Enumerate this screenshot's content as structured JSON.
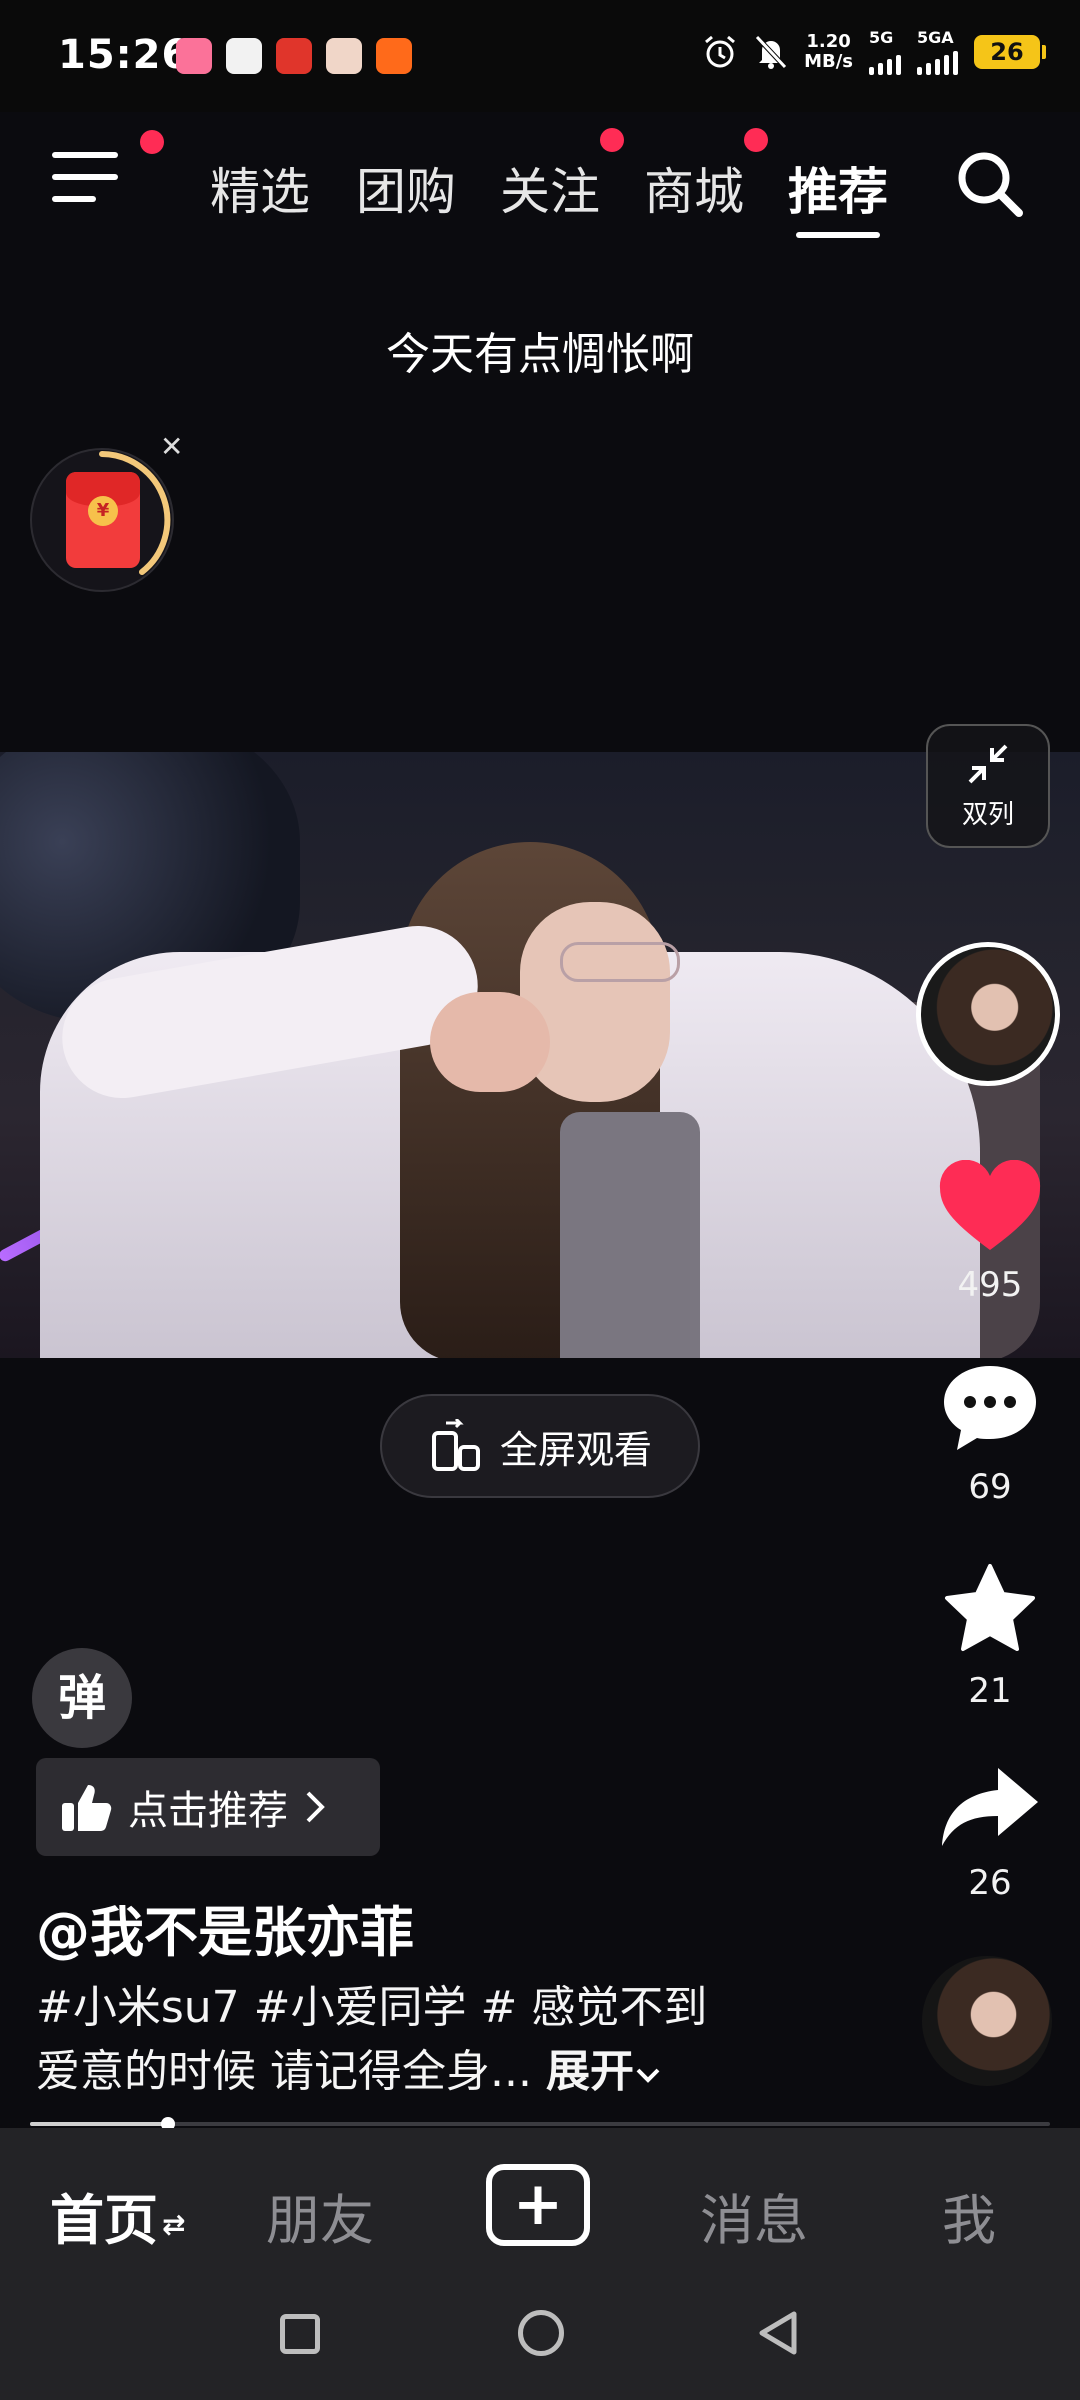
{
  "status_bar": {
    "time": "15:26",
    "net_speed_value": "1.20",
    "net_speed_unit": "MB/s",
    "sim1": "5G",
    "sim2": "5GA",
    "battery": "26",
    "notification_apps": [
      "bilibili-icon",
      "app-icon",
      "music-icon",
      "avatar-app-icon",
      "feishu-icon"
    ]
  },
  "top_nav": {
    "tabs": [
      {
        "label": "精选",
        "dot": false
      },
      {
        "label": "团购",
        "dot": false
      },
      {
        "label": "关注",
        "dot": true
      },
      {
        "label": "商城",
        "dot": true
      },
      {
        "label": "推荐",
        "dot": false,
        "active": true
      }
    ]
  },
  "video": {
    "caption": "今天有点惆怅啊",
    "fullscreen_label": "全屏观看"
  },
  "red_packet": {
    "coin": "¥"
  },
  "right_rail": {
    "dual_col_label": "双列",
    "likes": "495",
    "comments": "69",
    "favorites": "21",
    "shares": "26"
  },
  "post": {
    "danmu_label": "弹",
    "recommend_label": "点击推荐",
    "author": "@我不是张亦菲",
    "desc_line1": "#小米su7 #小爱同学 # 感觉不到",
    "desc_line2": "爱意的时候 请记得全身...",
    "expand_label": "展开"
  },
  "progress": {
    "fraction": 0.135
  },
  "bottom_nav": {
    "home": "首页",
    "friends": "朋友",
    "add": "+",
    "messages": "消息",
    "me": "我"
  },
  "colors": {
    "accent_red": "#ff2c55",
    "like_red": "#fe2c55",
    "battery_yellow": "#f5c518",
    "background": "#0b0b0f"
  }
}
